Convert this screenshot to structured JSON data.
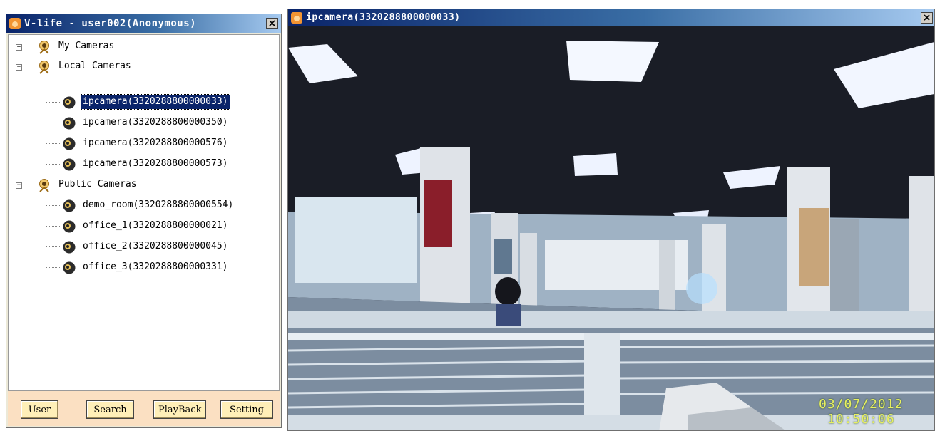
{
  "left_window": {
    "title": "V-life - user002(Anonymous)",
    "close_glyph": "×"
  },
  "tree": {
    "groups": [
      {
        "label": "My Cameras",
        "expanded": false,
        "expander": "+",
        "cameras": []
      },
      {
        "label": "Local Cameras",
        "expanded": true,
        "expander": "−",
        "cameras": [
          {
            "label": "ipcamera(3320288800000033)",
            "selected": true
          },
          {
            "label": "ipcamera(3320288800000350)",
            "selected": false
          },
          {
            "label": "ipcamera(3320288800000576)",
            "selected": false
          },
          {
            "label": "ipcamera(3320288800000573)",
            "selected": false
          }
        ]
      },
      {
        "label": "Public Cameras",
        "expanded": true,
        "expander": "−",
        "cameras": [
          {
            "label": "demo_room(3320288800000554)",
            "selected": false
          },
          {
            "label": "office_1(3320288800000021)",
            "selected": false
          },
          {
            "label": "office_2(3320288800000045)",
            "selected": false
          },
          {
            "label": "office_3(3320288800000331)",
            "selected": false
          }
        ]
      }
    ]
  },
  "buttons": {
    "user": "User",
    "search": "Search",
    "playback": "PlayBack",
    "setting": "Setting"
  },
  "right_window": {
    "title": "ipcamera(3320288800000033)",
    "close_glyph": "×"
  },
  "video": {
    "date": "03/07/2012",
    "time": "10:50:06"
  },
  "colors": {
    "titlebar_start": "#0a246a",
    "titlebar_end": "#a6caf0",
    "button_bar_bg": "#fbe0c2",
    "button_bg": "#ffefb8",
    "selection": "#0a246a",
    "timestamp": "#e8f060"
  },
  "icons": {
    "app": "app-logo-icon",
    "group": "camera-group-icon",
    "camera": "camera-icon",
    "close": "close-icon"
  }
}
